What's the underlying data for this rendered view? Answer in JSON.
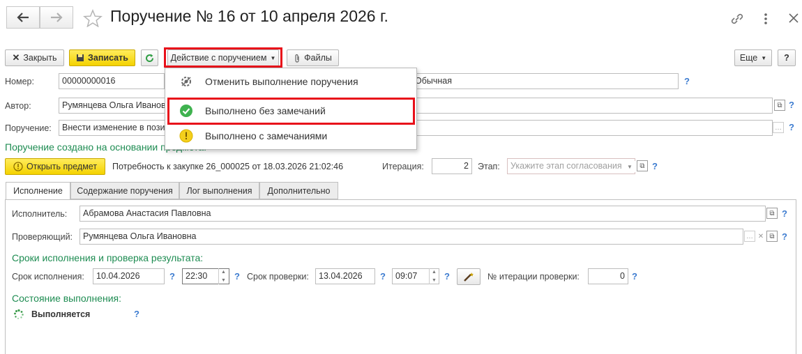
{
  "window": {
    "title": "Поручение № 16 от 10 апреля 2026 г."
  },
  "toolbar": {
    "close_label": "Закрыть",
    "save_label": "Записать",
    "action_label": "Действие с поручением",
    "files_label": "Файлы",
    "more_label": "Еще",
    "help_label": "?"
  },
  "menu": {
    "items": [
      {
        "label": "Отменить выполнение поручения",
        "icon": "cancel-gear-icon"
      },
      {
        "label": "Выполнено без замечаний",
        "icon": "green-check-icon"
      },
      {
        "label": "Выполнено с замечаниями",
        "icon": "yellow-warning-icon"
      }
    ]
  },
  "form": {
    "number_label": "Номер:",
    "number_value": "00000000016",
    "priority_value": "Обычная",
    "author_label": "Автор:",
    "author_value": "Румянцева Ольга Иванов",
    "task_label": "Поручение:",
    "task_value": "Внести изменение в пози",
    "based_on_text": "Поручение создано на основании предмета:",
    "open_subject_label": "Открыть предмет",
    "need_text": "Потребность к закупке 26_000025 от 18.03.2026 21:02:46",
    "iteration_label": "Итерация:",
    "iteration_value": "2",
    "stage_label": "Этап:",
    "stage_placeholder": "Укажите этап согласования",
    "help": "?"
  },
  "tabs": [
    "Исполнение",
    "Содержание поручения",
    "Лог выполнения",
    "Дополнительно"
  ],
  "execution": {
    "executor_label": "Исполнитель:",
    "executor_value": "Абрамова Анастасия Павловна",
    "checker_label": "Проверяющий:",
    "checker_value": "Румянцева Ольга Ивановна",
    "deadlines_header": "Сроки исполнения и проверка результата:",
    "due_label": "Срок исполнения:",
    "due_date": "10.04.2026",
    "due_time": "22:30",
    "check_label": "Срок проверки:",
    "check_date": "13.04.2026",
    "check_time": "09:07",
    "check_iter_label": "№ итерации проверки:",
    "check_iter_value": "0",
    "state_header": "Состояние выполнения:",
    "state_value": "Выполняется"
  },
  "colors": {
    "accent_green": "#1e8c52",
    "highlight_red": "#e8101a",
    "help_blue": "#3d7cd0",
    "save_yellow": "#f4d200"
  }
}
